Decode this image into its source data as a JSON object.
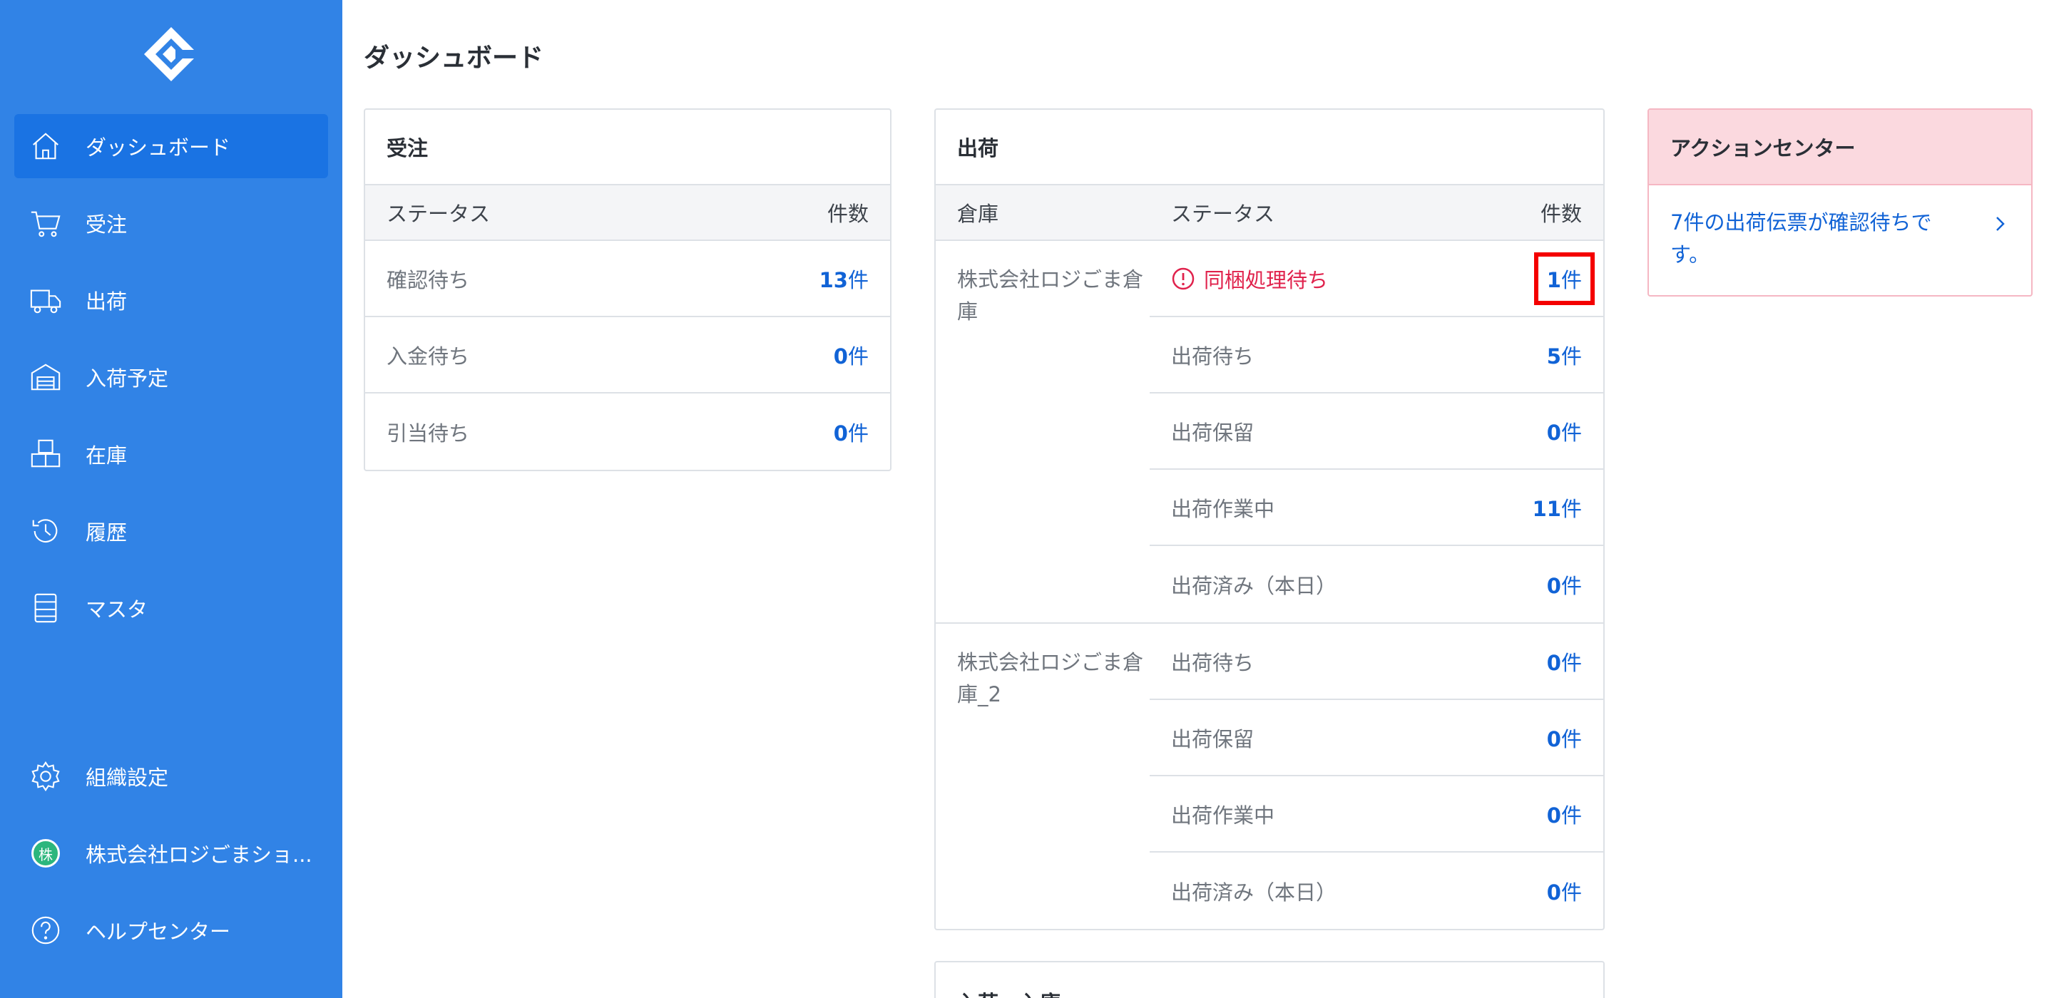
{
  "sidebar": {
    "items": [
      {
        "label": "ダッシュボード",
        "icon": "home-icon"
      },
      {
        "label": "受注",
        "icon": "cart-icon"
      },
      {
        "label": "出荷",
        "icon": "truck-icon"
      },
      {
        "label": "入荷予定",
        "icon": "warehouse-icon"
      },
      {
        "label": "在庫",
        "icon": "boxes-icon"
      },
      {
        "label": "履歴",
        "icon": "history-icon"
      },
      {
        "label": "マスタ",
        "icon": "list-icon"
      }
    ],
    "bottom": {
      "settings": "組織設定",
      "org_badge": "株",
      "org_name": "株式会社ロジごまショ...",
      "help": "ヘルプセンター"
    }
  },
  "page": {
    "title": "ダッシュボード"
  },
  "orders": {
    "title": "受注",
    "headers": {
      "status": "ステータス",
      "count": "件数"
    },
    "rows": [
      {
        "status": "確認待ち",
        "count": "13",
        "unit": "件"
      },
      {
        "status": "入金待ち",
        "count": "0",
        "unit": "件"
      },
      {
        "status": "引当待ち",
        "count": "0",
        "unit": "件"
      }
    ]
  },
  "shipments": {
    "title": "出荷",
    "headers": {
      "warehouse": "倉庫",
      "status": "ステータス",
      "count": "件数"
    },
    "groups": [
      {
        "warehouse": "株式会社ロジごま倉庫",
        "rows": [
          {
            "status": "同梱処理待ち",
            "count": "1",
            "unit": "件"
          },
          {
            "status": "出荷待ち",
            "count": "5",
            "unit": "件"
          },
          {
            "status": "出荷保留",
            "count": "0",
            "unit": "件"
          },
          {
            "status": "出荷作業中",
            "count": "11",
            "unit": "件"
          },
          {
            "status": "出荷済み（本日）",
            "count": "0",
            "unit": "件"
          }
        ]
      },
      {
        "warehouse": "株式会社ロジごま倉庫_2",
        "rows": [
          {
            "status": "出荷待ち",
            "count": "0",
            "unit": "件"
          },
          {
            "status": "出荷保留",
            "count": "0",
            "unit": "件"
          },
          {
            "status": "出荷作業中",
            "count": "0",
            "unit": "件"
          },
          {
            "status": "出荷済み（本日）",
            "count": "0",
            "unit": "件"
          }
        ]
      }
    ]
  },
  "action_center": {
    "title": "アクションセンター",
    "message": "7件の出荷伝票が確認待ちです。"
  },
  "receiving": {
    "title": "入荷・入庫"
  },
  "colors": {
    "sidebar": "#3183e6",
    "sidebar_active": "#1a73e3",
    "count_blue": "#1163d6",
    "alert_red": "#e0224c",
    "highlight_red": "#f40000",
    "action_header": "#fbd9df"
  }
}
